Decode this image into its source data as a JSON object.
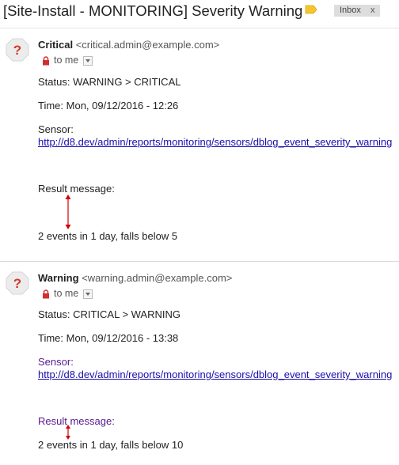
{
  "subject": "[Site-Install - MONITORING] Severity Warning",
  "icons": {
    "label": "label-tag-icon",
    "avatar": "unknown-sender-icon",
    "lock": "lock-icon",
    "dropdown": "chevron-down-icon",
    "annotation": "double-arrow-icon"
  },
  "colors": {
    "accent_lock": "#d22f2f",
    "link": "#1a0dab",
    "visited": "#551a8b",
    "annotation": "#d00000",
    "label_tag": "#f3c630"
  },
  "inbox_chip": {
    "label": "Inbox",
    "close": "x"
  },
  "messages": [
    {
      "sender_name": "Critical",
      "sender_email": "<critical.admin@example.com>",
      "to": "to me",
      "status": "Status: WARNING > CRITICAL",
      "time": "Time: Mon, 09/12/2016 - 12:26",
      "sensor_label": "Sensor:",
      "sensor_link": "http://d8.dev/admin/reports/monitoring/sensors/dblog_event_severity_warning",
      "result_label": "Result message:",
      "result": "2 events in 1 day, falls below 5"
    },
    {
      "sender_name": "Warning",
      "sender_email": "<warning.admin@example.com>",
      "to": "to me",
      "status": "Status: CRITICAL > WARNING",
      "time": "Time: Mon, 09/12/2016 - 13:38",
      "sensor_label": "Sensor:",
      "sensor_link": "http://d8.dev/admin/reports/monitoring/sensors/dblog_event_severity_warning",
      "result_label": "Result message:",
      "result": "2 events in 1 day, falls below 10"
    }
  ]
}
